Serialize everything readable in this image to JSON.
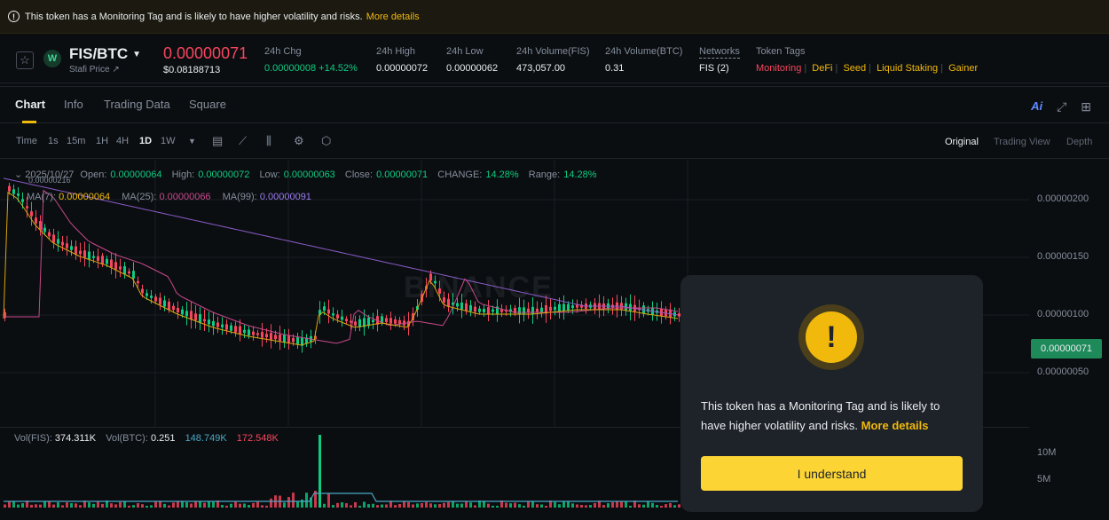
{
  "banner": {
    "text": "This token has a Monitoring Tag and is likely to have higher volatility and risks.",
    "link": "More details",
    "icon": "info-icon"
  },
  "ticker": {
    "pair": "FIS/BTC",
    "subname": "Stafi Price",
    "price": "0.00000071",
    "usd_price": "$0.08188713",
    "stats": [
      {
        "label": "24h Chg",
        "value": "0.00000008 +14.52%"
      },
      {
        "label": "24h High",
        "value": "0.00000072"
      },
      {
        "label": "24h Low",
        "value": "0.00000062"
      },
      {
        "label": "24h Volume(FIS)",
        "value": "473,057.00"
      },
      {
        "label": "24h Volume(BTC)",
        "value": "0.31"
      },
      {
        "label": "Networks",
        "value": "FIS (2)"
      }
    ],
    "tags_label": "Token Tags",
    "tags": [
      "Monitoring",
      "DeFi",
      "Seed",
      "Liquid Staking",
      "Gainer"
    ],
    "colors": {
      "up": "#0ecb81",
      "down": "#f6465d",
      "accent": "#f0b90b"
    }
  },
  "tabs": [
    "Chart",
    "Info",
    "Trading Data",
    "Square"
  ],
  "tab_icons": {
    "ai": "Ai"
  },
  "toolbar": {
    "timeframes": [
      "Time",
      "1s",
      "15m",
      "1H",
      "4H",
      "1D",
      "1W"
    ],
    "views": [
      "Original",
      "Trading View",
      "Depth"
    ]
  },
  "chart": {
    "ohlc": {
      "date": "2025/10/27",
      "open_label": "Open:",
      "open": "0.00000064",
      "high_label": "High:",
      "high": "0.00000072",
      "low_label": "Low:",
      "low": "0.00000063",
      "close_label": "Close:",
      "close": "0.00000071",
      "change_label": "CHANGE:",
      "change": "14.28%",
      "range_label": "Range:",
      "range": "14.28%"
    },
    "high_mark": "0.00000216",
    "ma": {
      "ma7_label": "MA(7):",
      "ma7": "0.00000064",
      "ma25_label": "MA(25):",
      "ma25": "0.00000066",
      "ma99_label": "MA(99):",
      "ma99": "0.00000091"
    },
    "y_axis": [
      "0.00000200",
      "0.00000150",
      "0.00000100",
      "0.00000050"
    ],
    "last_price": "0.00000071",
    "volume": {
      "vol_fis_label": "Vol(FIS):",
      "vol_fis": "374.311K",
      "vol_btc_label": "Vol(BTC):",
      "vol_btc": "0.251",
      "ma1": "148.749K",
      "ma2": "172.548K"
    },
    "vol_axis": [
      "10M",
      "5M"
    ],
    "watermark": "BINANCE"
  },
  "modal": {
    "text": "This token has a Monitoring Tag and is likely to have higher volatility and risks.",
    "link": "More details",
    "button": "I understand",
    "icon": "warning-icon"
  }
}
